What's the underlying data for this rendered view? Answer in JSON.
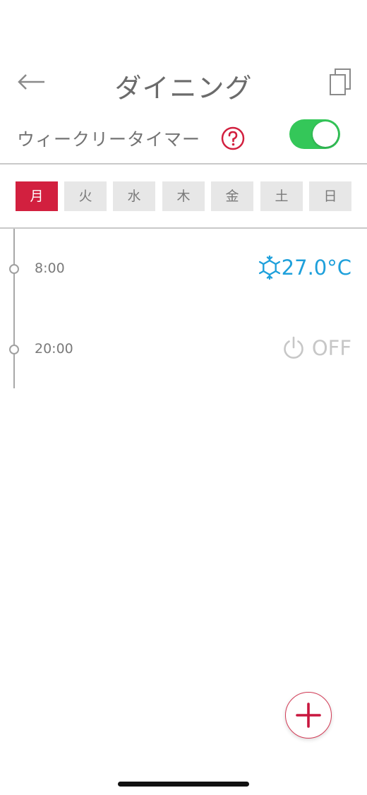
{
  "header": {
    "title": "ダイニング",
    "back_icon": "arrow-left-icon",
    "copy_icon": "copy-icon"
  },
  "weekly_timer": {
    "label": "ウィークリータイマー",
    "help_icon": "question-circle-icon",
    "enabled": true,
    "toggle_color": "#34c759"
  },
  "days": [
    {
      "label": "月",
      "selected": true
    },
    {
      "label": "火",
      "selected": false
    },
    {
      "label": "水",
      "selected": false
    },
    {
      "label": "木",
      "selected": false
    },
    {
      "label": "金",
      "selected": false
    },
    {
      "label": "土",
      "selected": false
    },
    {
      "label": "日",
      "selected": false
    }
  ],
  "schedule": [
    {
      "time": "8:00",
      "mode": "cooling",
      "icon": "snowflake-icon",
      "value": "27.0°C",
      "color": "#1ea0db"
    },
    {
      "time": "20:00",
      "mode": "off",
      "icon": "power-icon",
      "value": "OFF",
      "color": "#c7c7c7"
    }
  ],
  "add_button_icon": "plus-icon",
  "colors": {
    "accent": "#d2203f",
    "cool": "#1ea0db",
    "toggle_on": "#34c759"
  }
}
